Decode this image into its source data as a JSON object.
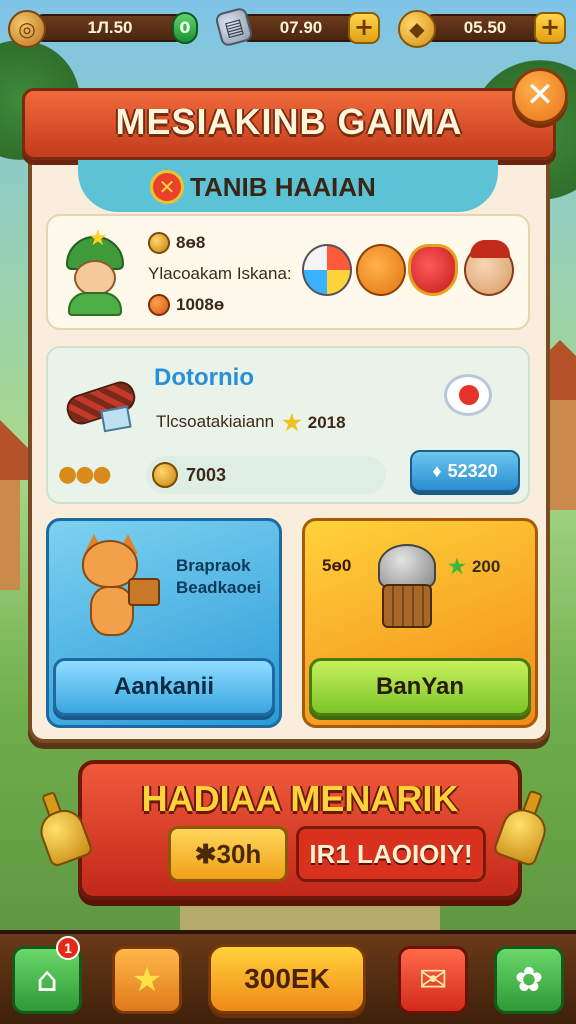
{
  "currencies": [
    {
      "icon": "coin-icon",
      "value": "1Л.50",
      "action_icon": "green-pill-icon"
    },
    {
      "icon": "ticket-icon",
      "value": "07.90",
      "action_icon": "plus-icon"
    },
    {
      "icon": "gold-pile-icon",
      "value": "05.50",
      "action_icon": "plus-icon"
    }
  ],
  "dialog": {
    "title": "MESIAKINB GAIMA",
    "close_glyph": "✕",
    "section_title": "TANIB HAAIAN",
    "player_card": {
      "stat1": "8ɵ8",
      "description": "Ylacoakam Iskana:",
      "stat2": "1008ɵ"
    },
    "offer_card": {
      "title": "Dotornio",
      "description": "Tlcsoatakiaiann",
      "stat": "2018",
      "coins": "7003",
      "price": "52320"
    },
    "reward_left": {
      "line1": "Brapraok",
      "line2": "Beadkaoei",
      "button": "Aankanii"
    },
    "reward_right": {
      "left_value": "5ɵ0",
      "right_value": "200",
      "button": "BanYan"
    }
  },
  "promo": {
    "title": "HADIAA MENARIK",
    "chip1": "✱30h",
    "chip2": "IR1 LAOIOIY!"
  },
  "bottom_nav": {
    "home_badge": "1",
    "main_button": "300EK"
  },
  "colors": {
    "banner": "#e2532e",
    "panel": "#f8eedb",
    "accent_blue": "#2a9ad8",
    "accent_orange": "#f28a18",
    "accent_green": "#7cc62a"
  }
}
